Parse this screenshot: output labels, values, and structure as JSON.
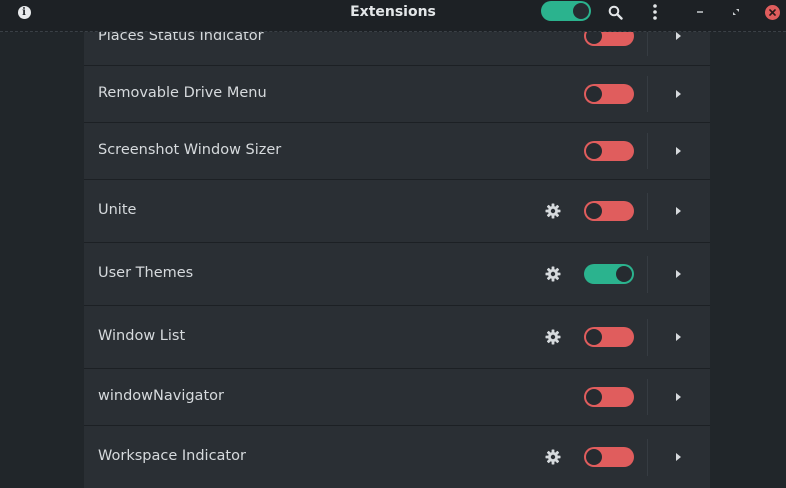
{
  "header": {
    "title": "Extensions",
    "global_toggle_on": true,
    "icons": [
      "info-icon",
      "search-icon",
      "kebab-menu-icon",
      "minimize-icon",
      "maximize-icon",
      "close-icon"
    ]
  },
  "colors": {
    "switch_off": "#e05d5d",
    "switch_on": "#2bb38e",
    "background": "#21262a",
    "list_background": "#2a2f34"
  },
  "extensions": [
    {
      "name": "Places Status Indicator",
      "has_settings": false,
      "enabled": false
    },
    {
      "name": "Removable Drive Menu",
      "has_settings": false,
      "enabled": false
    },
    {
      "name": "Screenshot Window Sizer",
      "has_settings": false,
      "enabled": false
    },
    {
      "name": "Unite",
      "has_settings": true,
      "enabled": false
    },
    {
      "name": "User Themes",
      "has_settings": true,
      "enabled": true
    },
    {
      "name": "Window List",
      "has_settings": true,
      "enabled": false
    },
    {
      "name": "windowNavigator",
      "has_settings": false,
      "enabled": false
    },
    {
      "name": "Workspace Indicator",
      "has_settings": true,
      "enabled": false
    }
  ]
}
